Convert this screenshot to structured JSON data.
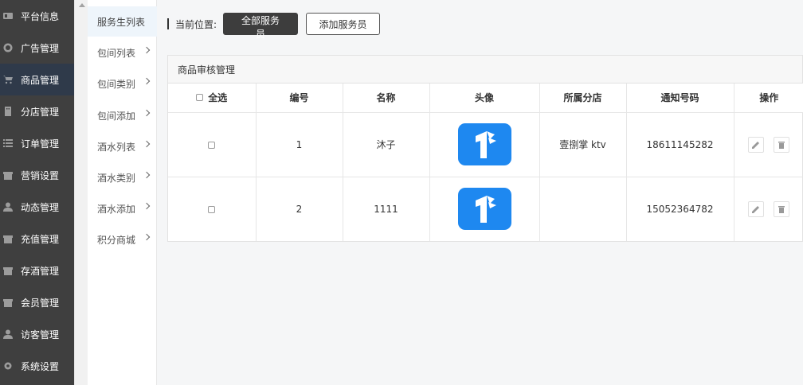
{
  "sidebar": {
    "items": [
      {
        "label": "平台信息",
        "icon": "id-card-icon"
      },
      {
        "label": "广告管理",
        "icon": "globe-icon"
      },
      {
        "label": "商品管理",
        "icon": "cart-icon"
      },
      {
        "label": "分店管理",
        "icon": "building-icon"
      },
      {
        "label": "订单管理",
        "icon": "list-icon"
      },
      {
        "label": "营销设置",
        "icon": "gift-icon"
      },
      {
        "label": "动态管理",
        "icon": "user-icon"
      },
      {
        "label": "充值管理",
        "icon": "gift-icon"
      },
      {
        "label": "存酒管理",
        "icon": "gift-icon"
      },
      {
        "label": "会员管理",
        "icon": "gift-icon"
      },
      {
        "label": "访客管理",
        "icon": "user-icon"
      },
      {
        "label": "系统设置",
        "icon": "gear-icon"
      }
    ],
    "active_index": 2
  },
  "subnav": {
    "items": [
      {
        "label": "服务生列表"
      },
      {
        "label": "包间列表"
      },
      {
        "label": "包间类别"
      },
      {
        "label": "包间添加"
      },
      {
        "label": "酒水列表"
      },
      {
        "label": "酒水类别"
      },
      {
        "label": "酒水添加"
      },
      {
        "label": "积分商城"
      }
    ]
  },
  "location": {
    "label": "当前位置:",
    "primary_button": "全部服务员",
    "secondary_button": "添加服务员"
  },
  "panel": {
    "title": "商品审核管理",
    "columns": [
      "全选",
      "编号",
      "名称",
      "头像",
      "所属分店",
      "通知号码",
      "操作"
    ],
    "rows": [
      {
        "id": "1",
        "name": "沐子",
        "branch": "壹捌掌 ktv",
        "phone": "18611145282"
      },
      {
        "id": "2",
        "name": "1111",
        "branch": "",
        "phone": "15052364782"
      }
    ]
  },
  "colors": {
    "sidebar_bg": "#3f3f3f",
    "sidebar_active": "#2f3a4a",
    "avatar_blue": "#1e88f0",
    "primary_button": "#3d3d3d"
  }
}
